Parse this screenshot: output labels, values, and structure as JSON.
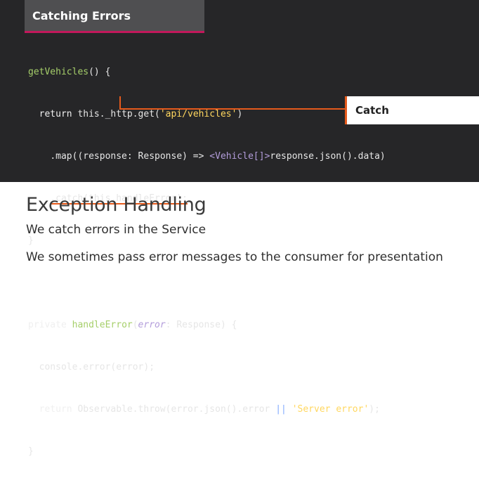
{
  "slide": {
    "title": "Catching Errors",
    "callout": "Catch",
    "heading": "Exception Handling",
    "bullets": [
      "We catch errors in the Service",
      "We sometimes pass error messages to the consumer for presentation"
    ]
  },
  "code": {
    "l1": {
      "fn": "getVehicles",
      "rest": "() {"
    },
    "l2": {
      "ret": "return",
      "a": " this._http.get(",
      "s": "'api/vehicles'",
      "b": ")"
    },
    "l3": {
      "a": ".map((response: Response) => ",
      "g": "<Vehicle[]>",
      "b": "response.json().data)"
    },
    "l4": {
      "a": ".catch(this.handleError);"
    },
    "l5": {
      "a": "}"
    },
    "l7": {
      "kw": "private ",
      "fn": "handleError",
      "p1": "(",
      "par": "error",
      "p2": ": Response) {"
    },
    "l8": {
      "a": "console.error(error);"
    },
    "l9": {
      "ret": "return",
      "a": " Observable.throw(error.json().error ",
      "op": "||",
      "sp": " ",
      "s": "'Server error'",
      "b": ");"
    },
    "l10": {
      "a": "}"
    }
  },
  "colors": {
    "accent_pink": "#c2185b",
    "accent_orange": "#e55a1c",
    "code_bg": "#262628"
  }
}
